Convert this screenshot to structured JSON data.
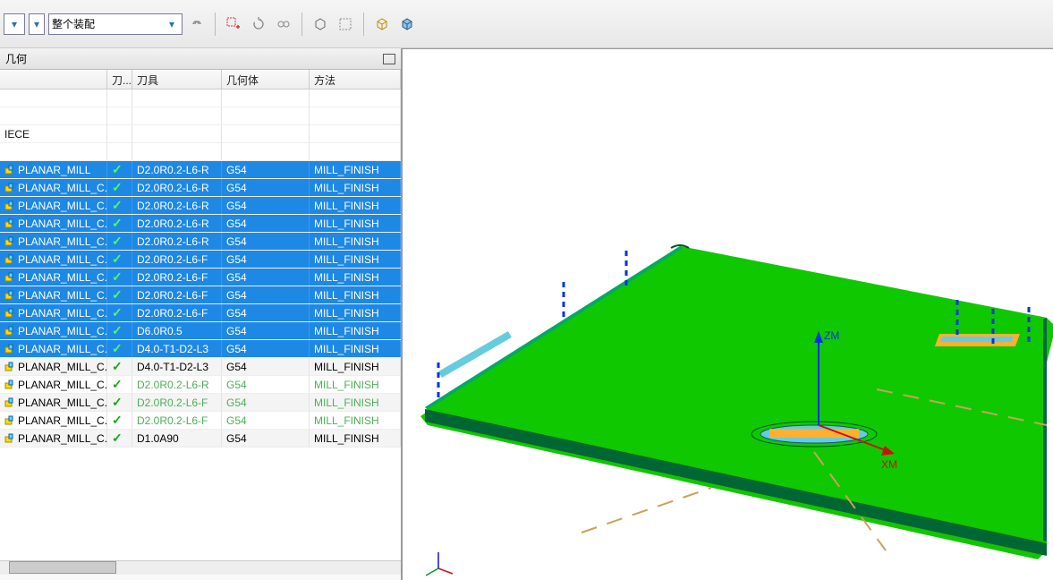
{
  "toolbar": {
    "assembly_dropdown": "整个装配"
  },
  "panel": {
    "title": "几何",
    "columns": {
      "flag": "刀...",
      "tool": "刀具",
      "geo": "几何体",
      "method": "方法"
    },
    "piece_label": "IECE"
  },
  "ops": [
    {
      "name": "PLANAR_MILL",
      "tool": "D2.0R0.2-L6-R",
      "geo": "G54",
      "method": "MILL_FINISH",
      "sel": true
    },
    {
      "name": "PLANAR_MILL_C...",
      "tool": "D2.0R0.2-L6-R",
      "geo": "G54",
      "method": "MILL_FINISH",
      "sel": true
    },
    {
      "name": "PLANAR_MILL_C...",
      "tool": "D2.0R0.2-L6-R",
      "geo": "G54",
      "method": "MILL_FINISH",
      "sel": true
    },
    {
      "name": "PLANAR_MILL_C...",
      "tool": "D2.0R0.2-L6-R",
      "geo": "G54",
      "method": "MILL_FINISH",
      "sel": true
    },
    {
      "name": "PLANAR_MILL_C...",
      "tool": "D2.0R0.2-L6-R",
      "geo": "G54",
      "method": "MILL_FINISH",
      "sel": true
    },
    {
      "name": "PLANAR_MILL_C...",
      "tool": "D2.0R0.2-L6-F",
      "geo": "G54",
      "method": "MILL_FINISH",
      "sel": true
    },
    {
      "name": "PLANAR_MILL_C...",
      "tool": "D2.0R0.2-L6-F",
      "geo": "G54",
      "method": "MILL_FINISH",
      "sel": true
    },
    {
      "name": "PLANAR_MILL_C...",
      "tool": "D2.0R0.2-L6-F",
      "geo": "G54",
      "method": "MILL_FINISH",
      "sel": true
    },
    {
      "name": "PLANAR_MILL_C...",
      "tool": "D2.0R0.2-L6-F",
      "geo": "G54",
      "method": "MILL_FINISH",
      "sel": true
    },
    {
      "name": "PLANAR_MILL_C...",
      "tool": "D6.0R0.5",
      "geo": "G54",
      "method": "MILL_FINISH",
      "sel": true
    },
    {
      "name": "PLANAR_MILL_C...",
      "tool": "D4.0-T1-D2-L3",
      "geo": "G54",
      "method": "MILL_FINISH",
      "sel": true
    },
    {
      "name": "PLANAR_MILL_C...",
      "tool": "D4.0-T1-D2-L3",
      "geo": "G54",
      "method": "MILL_FINISH",
      "sel": false,
      "style": "plain"
    },
    {
      "name": "PLANAR_MILL_C...",
      "tool": "D2.0R0.2-L6-R",
      "geo": "G54",
      "method": "MILL_FINISH",
      "sel": false,
      "style": "dim"
    },
    {
      "name": "PLANAR_MILL_C...",
      "tool": "D2.0R0.2-L6-F",
      "geo": "G54",
      "method": "MILL_FINISH",
      "sel": false,
      "style": "dim"
    },
    {
      "name": "PLANAR_MILL_C...",
      "tool": "D2.0R0.2-L6-F",
      "geo": "G54",
      "method": "MILL_FINISH",
      "sel": false,
      "style": "dim"
    },
    {
      "name": "PLANAR_MILL_C...",
      "tool": "D1.0A90",
      "geo": "G54",
      "method": "MILL_FINISH",
      "sel": false,
      "style": "plain"
    }
  ],
  "viewport": {
    "axis_labels": {
      "x": "XM",
      "z": "ZM"
    }
  }
}
